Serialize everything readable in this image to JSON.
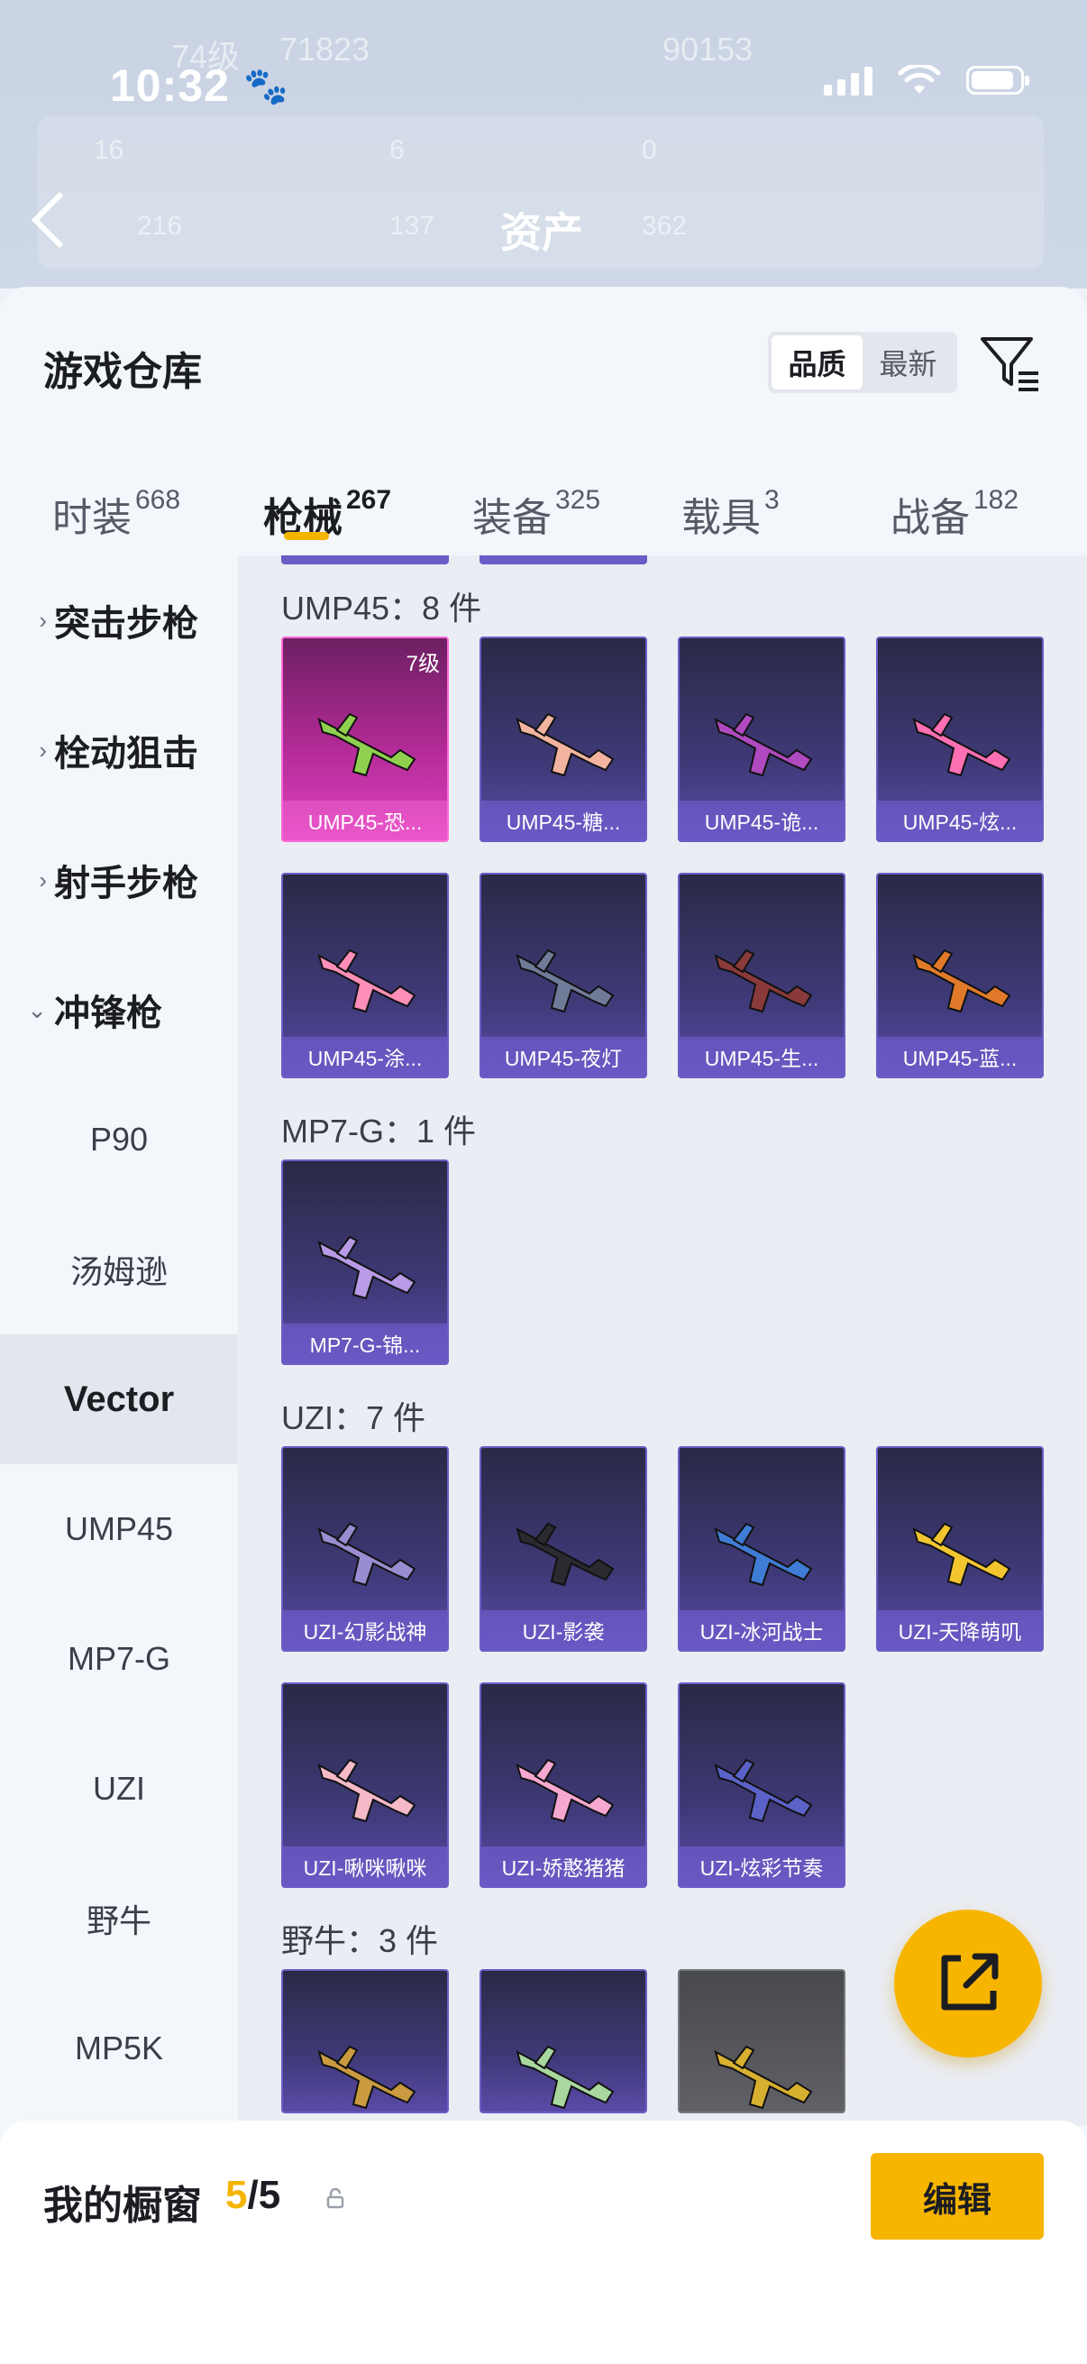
{
  "status_bar": {
    "time": "10:32"
  },
  "header": {
    "title": "资产",
    "ghost_numbers": [
      "74级",
      "71823",
      "90153",
      "16",
      "6",
      "0",
      "216",
      "137",
      "362"
    ]
  },
  "warehouse": {
    "title": "游戏仓库",
    "sort": {
      "quality": "品质",
      "newest": "最新"
    },
    "tabs": [
      {
        "label": "时装",
        "count": "668"
      },
      {
        "label": "枪械",
        "count": "267"
      },
      {
        "label": "装备",
        "count": "325"
      },
      {
        "label": "载具",
        "count": "3"
      },
      {
        "label": "战备",
        "count": "182"
      }
    ]
  },
  "sidebar": {
    "categories": [
      {
        "label": "突击步枪",
        "chevron": "›"
      },
      {
        "label": "栓动狙击",
        "chevron": "›"
      },
      {
        "label": "射手步枪",
        "chevron": "›"
      },
      {
        "label": "冲锋枪",
        "chevron": "⌄"
      }
    ],
    "subitems": [
      "P90",
      "汤姆逊",
      "Vector",
      "UMP45",
      "MP7-G",
      "UZI",
      "野牛",
      "MP5K"
    ]
  },
  "groups": [
    {
      "title": "UMP45：8 件",
      "items": [
        {
          "name": "UMP45-恐...",
          "level": "7级"
        },
        {
          "name": "UMP45-糖..."
        },
        {
          "name": "UMP45-诡..."
        },
        {
          "name": "UMP45-炫..."
        },
        {
          "name": "UMP45-涂..."
        },
        {
          "name": "UMP45-夜灯"
        },
        {
          "name": "UMP45-生..."
        },
        {
          "name": "UMP45-蓝..."
        }
      ]
    },
    {
      "title": "MP7-G：1 件",
      "items": [
        {
          "name": "MP7-G-锦..."
        }
      ]
    },
    {
      "title": "UZI：7 件",
      "items": [
        {
          "name": "UZI-幻影战神"
        },
        {
          "name": "UZI-影袭"
        },
        {
          "name": "UZI-冰河战士"
        },
        {
          "name": "UZI-天降萌叽"
        },
        {
          "name": "UZI-啾咪啾咪"
        },
        {
          "name": "UZI-娇憨猪猪"
        },
        {
          "name": "UZI-炫彩节奏"
        }
      ]
    },
    {
      "title": "野牛：3 件",
      "items": [
        {},
        {},
        {}
      ]
    }
  ],
  "bottom_bar": {
    "label": "我的橱窗",
    "current": "5",
    "separator": "/",
    "total": "5",
    "edit": "编辑"
  },
  "colors": {
    "accent": "#f7b500",
    "purple_card": "#3f3a78",
    "pink_card": "#b32b97"
  }
}
